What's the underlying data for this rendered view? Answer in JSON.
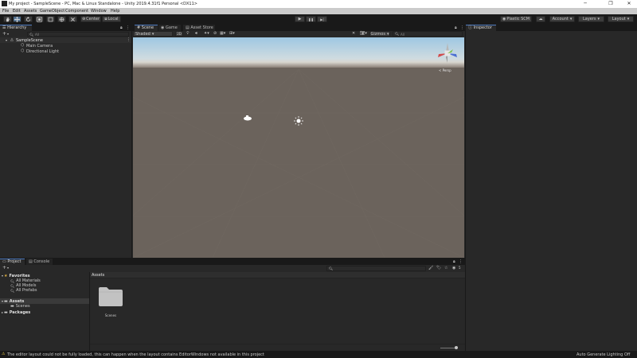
{
  "window": {
    "title": "My project - SampleScene - PC, Mac & Linux Standalone - Unity 2019.4.31f1 Personal <DX11>",
    "controls": [
      "─",
      "❐",
      "✕"
    ]
  },
  "menu": [
    "File",
    "Edit",
    "Assets",
    "GameObject",
    "Component",
    "Window",
    "Help"
  ],
  "toolbar": {
    "tools": [
      "hand-tool",
      "move-tool",
      "rotate-tool",
      "scale-tool",
      "rect-tool",
      "transform-tool",
      "custom-tool"
    ],
    "pivot": "Center",
    "space": "Local",
    "play": "▶",
    "pause": "❚❚",
    "step": "▶|",
    "plastic": "Plastic SCM",
    "account": "Account",
    "layers": "Layers",
    "layout": "Layout"
  },
  "hierarchy": {
    "tab": "Hierarchy",
    "add": "+",
    "search_placeholder": "All",
    "scene": "SampleScene",
    "items": [
      "Main Camera",
      "Directional Light"
    ]
  },
  "scene_view": {
    "tabs": [
      "Scene",
      "Game",
      "Asset Store"
    ],
    "shading": "Shaded",
    "mode_2d": "2D",
    "gizmos": "Gizmos",
    "search_placeholder": "All",
    "persp": "< Persp"
  },
  "inspector": {
    "tab": "Inspector"
  },
  "project": {
    "tabs": [
      "Project",
      "Console"
    ],
    "add": "+",
    "favorites": "Favorites",
    "favorite_items": [
      "All Materials",
      "All Models",
      "All Prefabs"
    ],
    "assets": "Assets",
    "asset_children": [
      "Scenes"
    ],
    "packages": "Packages",
    "breadcrumb": "Assets",
    "grid_items": [
      {
        "name": "Scenes",
        "icon": "folder-icon"
      }
    ],
    "badge_count": "5"
  },
  "status": {
    "message": "The editor layout could not be fully loaded, this can happen when the layout contains EditorWindows not available in this project",
    "right": "Auto Generate Lighting Off"
  }
}
